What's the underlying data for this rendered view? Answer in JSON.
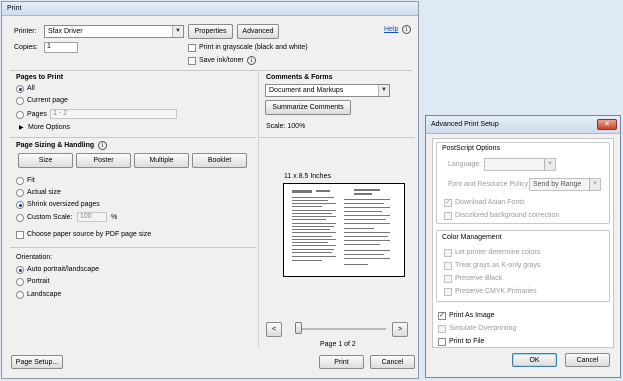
{
  "print_dialog": {
    "title": "Print",
    "help_link": "Help",
    "printer_label": "Printer:",
    "printer_value": "Sfax Driver",
    "properties_button": "Properties",
    "advanced_button": "Advanced",
    "copies_label": "Copies:",
    "copies_value": "1",
    "grayscale_label": "Print in grayscale (black and white)",
    "grayscale_checked": false,
    "save_ink_label": "Save ink/toner",
    "save_ink_checked": false,
    "pages_to_print": {
      "title": "Pages to Print",
      "all_label": "All",
      "current_page_label": "Current page",
      "pages_label": "Pages",
      "pages_value": "1 - 2",
      "more_options_label": "More Options",
      "selected": "All"
    },
    "page_sizing": {
      "title": "Page Sizing & Handling",
      "size_button": "Size",
      "poster_button": "Poster",
      "multiple_button": "Multiple",
      "booklet_button": "Booklet",
      "fit_label": "Fit",
      "actual_size_label": "Actual size",
      "shrink_label": "Shrink oversized pages",
      "custom_scale_label": "Custom Scale:",
      "custom_scale_value": "100",
      "percent_sign": "%",
      "paper_source_label": "Choose paper source by PDF page size",
      "selected": "Shrink oversized pages"
    },
    "orientation": {
      "title": "Orientation:",
      "auto_label": "Auto portrait/landscape",
      "portrait_label": "Portrait",
      "landscape_label": "Landscape",
      "selected": "Auto portrait/landscape"
    },
    "comments_forms": {
      "title": "Comments & Forms",
      "value": "Document and Markups",
      "summarize_button": "Summarize Comments"
    },
    "scale_label": "Scale: 100%",
    "preview": {
      "paper_size": "11 x 8.5 Inches",
      "prev_button": "<",
      "next_button": ">",
      "page_indicator": "Page 1 of 2"
    },
    "page_setup_button": "Page Setup...",
    "print_button": "Print",
    "cancel_button": "Cancel"
  },
  "advanced_dialog": {
    "title": "Advanced Print Setup",
    "postscript": {
      "title": "PostScript Options",
      "language_label": "Language:",
      "language_value": "",
      "font_label": "Font and Resource Policy:",
      "font_value": "Send by Range",
      "download_asian_label": "Download Asian Fonts",
      "download_asian_checked": true,
      "discolored_label": "Discolored background correction",
      "discolored_checked": false
    },
    "color_management": {
      "title": "Color Management",
      "printer_colors_label": "Let printer determine colors",
      "treat_grays_label": "Treat grays as K-only grays",
      "preserve_black_label": "Preserve Black",
      "preserve_cmyk_label": "Preserve CMYK Primaries"
    },
    "print_as_image_label": "Print As Image",
    "print_as_image_checked": true,
    "simulate_overprinting_label": "Simulate Overprinting",
    "print_to_file_label": "Print to File",
    "ok_button": "OK",
    "cancel_button": "Cancel"
  }
}
